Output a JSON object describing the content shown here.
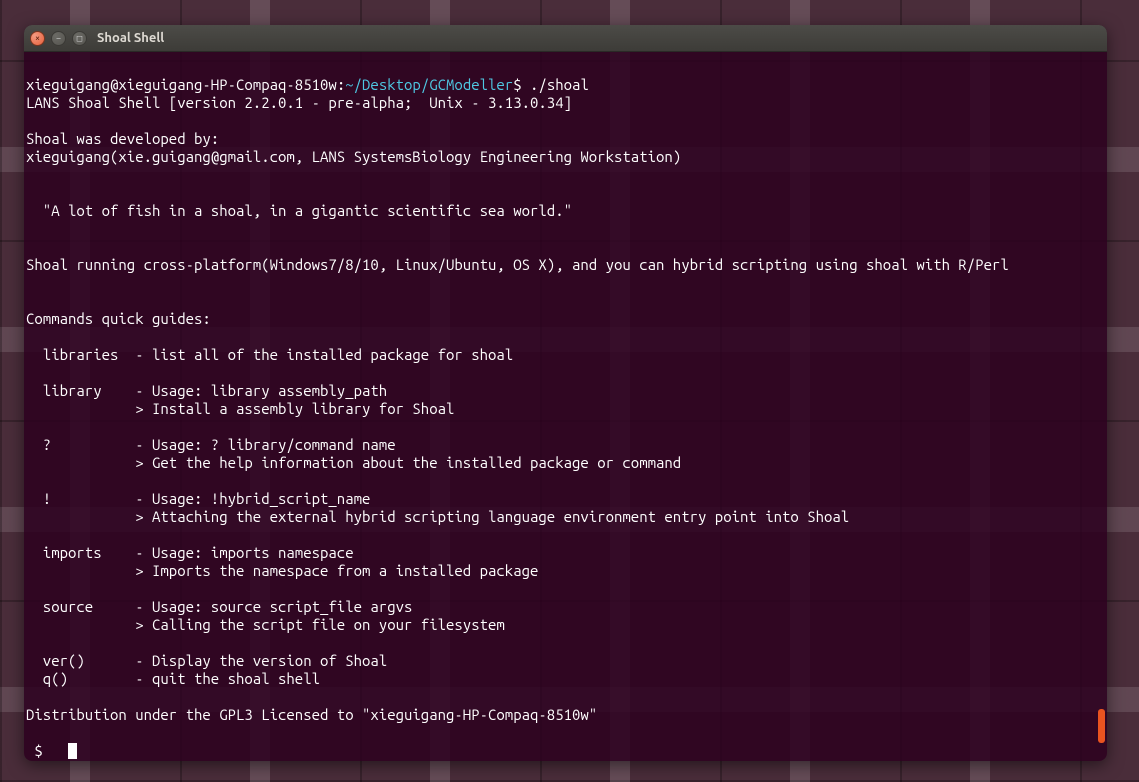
{
  "window": {
    "title": "Shoal Shell",
    "controls": {
      "close": "×",
      "minimize": "−",
      "maximize": "□"
    }
  },
  "terminal": {
    "initial_line": {
      "prompt_user_host": "xieguigang@xieguigang-HP-Compaq-8510w",
      "prompt_sep": ":",
      "prompt_path": "~/Desktop/GCModeller",
      "prompt_dollar": "$ ",
      "command": "./shoal"
    },
    "banner_line": "LANS Shoal Shell [version 2.2.0.1 - pre-alpha;  Unix - 3.13.0.34]",
    "developed_by_label": "Shoal was developed by:",
    "developer_line": "xieguigang(xie.guigang@gmail.com, LANS SystemsBiology Engineering Workstation)",
    "quote_line": "  \"A lot of fish in a shoal, in a gigantic scientific sea world.\"",
    "cross_platform_line": "Shoal running cross-platform(Windows7/8/10, Linux/Ubuntu, OS X), and you can hybrid scripting using shoal with R/Perl",
    "commands_guides_label": "Commands quick guides:",
    "commands": {
      "libraries": "  libraries  - list all of the installed package for shoal",
      "library_l1": "  library    - Usage: library assembly_path",
      "library_l2": "             > Install a assembly library for Shoal",
      "help_l1": "  ?          - Usage: ? library/command name",
      "help_l2": "             > Get the help information about the installed package or command",
      "bang_l1": "  !          - Usage: !hybrid_script_name",
      "bang_l2": "             > Attaching the external hybrid scripting language environment entry point into Shoal",
      "imports_l1": "  imports    - Usage: imports namespace",
      "imports_l2": "             > Imports the namespace from a installed package",
      "source_l1": "  source     - Usage: source script_file argvs",
      "source_l2": "             > Calling the script file on your filesystem",
      "ver": "  ver()      - Display the version of Shoal",
      "quit": "  q()        - quit the shoal shell"
    },
    "distribution_line": "Distribution under the GPL3 Licensed to \"xieguigang-HP-Compaq-8510w\"",
    "prompt_symbol": " $  "
  }
}
